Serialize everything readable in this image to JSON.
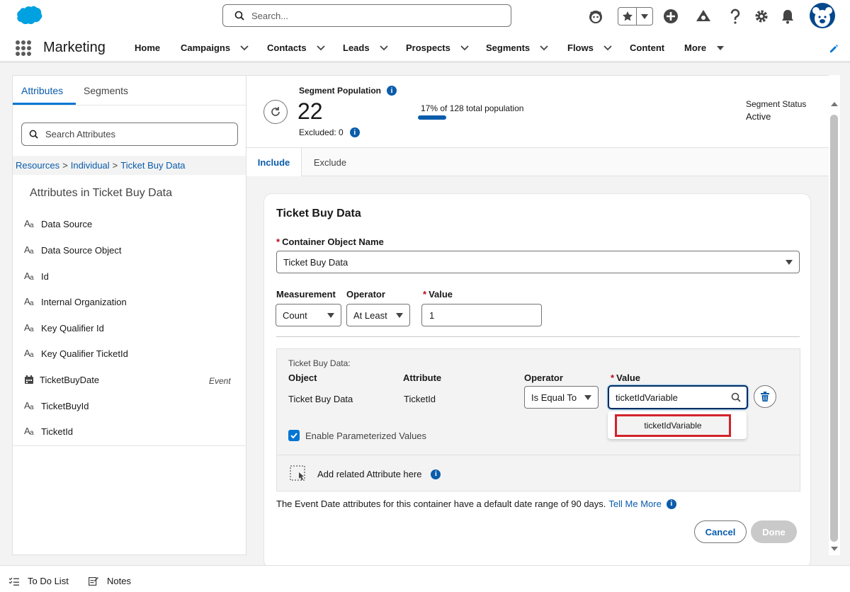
{
  "header": {
    "search_placeholder": "Search..."
  },
  "nav": {
    "app_name": "Marketing",
    "items": [
      {
        "label": "Home"
      },
      {
        "label": "Campaigns"
      },
      {
        "label": "Contacts"
      },
      {
        "label": "Leads"
      },
      {
        "label": "Prospects"
      },
      {
        "label": "Segments"
      },
      {
        "label": "Flows"
      },
      {
        "label": "Content"
      },
      {
        "label": "More"
      }
    ]
  },
  "left_panel": {
    "tabs": [
      {
        "label": "Attributes"
      },
      {
        "label": "Segments"
      }
    ],
    "search_placeholder": "Search Attributes",
    "breadcrumb": [
      "Resources",
      "Individual",
      "Ticket Buy Data"
    ],
    "heading": "Attributes in Ticket Buy Data",
    "attributes": [
      {
        "label": "Data Source",
        "icon": "text-type-icon"
      },
      {
        "label": "Data Source Object",
        "icon": "text-type-icon"
      },
      {
        "label": "Id",
        "icon": "text-type-icon"
      },
      {
        "label": "Internal Organization",
        "icon": "text-type-icon"
      },
      {
        "label": "Key Qualifier Id",
        "icon": "text-type-icon"
      },
      {
        "label": "Key Qualifier TicketId",
        "icon": "text-type-icon"
      },
      {
        "label": "TicketBuyDate",
        "icon": "calendar-icon",
        "tag": "Event"
      },
      {
        "label": "TicketBuyId",
        "icon": "text-type-icon"
      },
      {
        "label": "TicketId",
        "icon": "text-type-icon"
      }
    ]
  },
  "segment": {
    "population_label": "Segment Population",
    "count": "22",
    "excluded": "Excluded: 0",
    "pct_text": "17% of 128 total population",
    "pct_value": 0.17,
    "status_label": "Segment Status",
    "status_value": "Active"
  },
  "tabs": [
    {
      "label": "Include"
    },
    {
      "label": "Exclude"
    }
  ],
  "card": {
    "title": "Ticket Buy Data",
    "container_label": "Container Object Name",
    "container_value": "Ticket Buy Data",
    "measurement_label": "Measurement",
    "measurement_value": "Count",
    "operator_label": "Operator",
    "operator_value": "At Least",
    "value_label": "Value",
    "value_value": "1",
    "filter": {
      "sub_label": "Ticket Buy Data:",
      "col_object": "Object",
      "col_attribute": "Attribute",
      "col_operator": "Operator",
      "col_value": "Value",
      "object": "Ticket Buy Data",
      "attribute": "TicketId",
      "operator": "Is Equal To",
      "value": "ticketIdVariable",
      "dropdown_option": "ticketIdVariable",
      "param_label": "Enable Parameterized Values",
      "param_checked": true,
      "add_related": "Add related Attribute here"
    },
    "footnote": "The Event Date attributes for this container have a default date range of 90 days.",
    "footnote_link": "Tell Me More",
    "cancel": "Cancel",
    "done": "Done"
  },
  "utility_bar": {
    "todo": "To Do List",
    "notes": "Notes"
  },
  "colors": {
    "brand_blue": "#0176d3",
    "link_blue": "#0b5cab",
    "highlight_red": "#d2232a"
  }
}
